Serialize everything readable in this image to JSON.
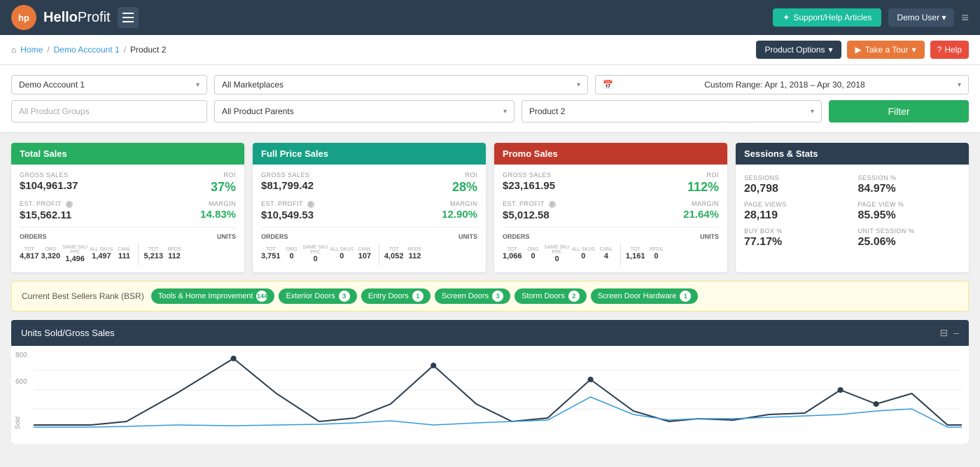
{
  "header": {
    "logo_initials": "hp",
    "logo_name_hello": "Hello",
    "logo_name_profit": "Profit",
    "support_btn": "Support/Help Articles",
    "demo_user": "Demo User",
    "support_icon": "⭐"
  },
  "breadcrumb": {
    "home": "Home",
    "account": "Demo Acccount 1",
    "product": "Product 2"
  },
  "breadcrumb_actions": {
    "product_options": "Product Options",
    "take_tour": "Take a Tour",
    "help": "Help"
  },
  "filters": {
    "account": "Demo Acccount 1",
    "marketplaces": "All Marketplaces",
    "date_range": "Custom Range: Apr 1, 2018 – Apr 30, 2018",
    "product_groups": "All Product Groups",
    "product_parents": "All Product Parents",
    "product_2": "Product 2",
    "filter_btn": "Filter"
  },
  "total_sales": {
    "title": "Total Sales",
    "gross_sales_label": "GROSS SALES",
    "gross_sales_value": "$104,961.37",
    "roi_label": "ROI",
    "roi_value": "37%",
    "est_profit_label": "EST. PROFIT",
    "est_profit_value": "$15,562.11",
    "margin_label": "MARGIN",
    "margin_value": "14.83%",
    "orders_label": "ORDERS",
    "units_label": "UNITS",
    "tot": "4,817",
    "org": "3,320",
    "same_sku_ppc": "1,496",
    "all_skus": "1,497",
    "canl": "111",
    "tot_units": "5,213",
    "rfds": "112"
  },
  "full_price_sales": {
    "title": "Full Price Sales",
    "gross_sales_label": "GROSS SALES",
    "gross_sales_value": "$81,799.42",
    "roi_label": "ROI",
    "roi_value": "28%",
    "est_profit_label": "EST. PROFIT",
    "est_profit_value": "$10,549.53",
    "margin_label": "MARGIN",
    "margin_value": "12.90%",
    "orders_label": "ORDERS",
    "units_label": "UNITS",
    "tot": "3,751",
    "org": "0",
    "same_sku_ppc": "0",
    "all_skus": "0",
    "canl": "107",
    "tot_units": "4,052",
    "rfds": "112"
  },
  "promo_sales": {
    "title": "Promo Sales",
    "gross_sales_label": "GROSS SALES",
    "gross_sales_value": "$23,161.95",
    "roi_label": "ROI",
    "roi_value": "112%",
    "est_profit_label": "EST. PROFIT",
    "est_profit_value": "$5,012.58",
    "margin_label": "MARGIN",
    "margin_value": "21.64%",
    "orders_label": "ORDERS",
    "units_label": "UNITS",
    "tot": "1,066",
    "org": "0",
    "same_sku_ppc": "0",
    "all_skus": "0",
    "canl": "4",
    "tot_units": "1,161",
    "rfds": "0"
  },
  "sessions": {
    "title": "Sessions & Stats",
    "sessions_label": "SESSIONS",
    "sessions_value": "20,798",
    "session_pct_label": "SESSION %",
    "session_pct_value": "84.97%",
    "page_views_label": "PAGE VIEWS",
    "page_views_value": "28,119",
    "page_view_pct_label": "PAGE VIEW %",
    "page_view_pct_value": "85.95%",
    "buy_box_label": "BUY BOX %",
    "buy_box_value": "77.17%",
    "unit_session_label": "UNIT SESSION %",
    "unit_session_value": "25.06%"
  },
  "bsr": {
    "label": "Current Best Sellers Rank (BSR)",
    "tags": [
      {
        "name": "Tools & Home Improvement",
        "count": "144"
      },
      {
        "name": "Exterior Doors",
        "count": "3"
      },
      {
        "name": "Entry Doors",
        "count": "1"
      },
      {
        "name": "Screen Doors",
        "count": "3"
      },
      {
        "name": "Storm Doors",
        "count": "2"
      },
      {
        "name": "Screen Door Hardware",
        "count": "1"
      }
    ]
  },
  "chart": {
    "title": "Units Sold/Gross Sales",
    "y_label_800": "800",
    "y_label_600": "600",
    "x_label": "Sold",
    "expand_icon": "⊟",
    "minimize_icon": "–"
  },
  "colors": {
    "green": "#27ae60",
    "teal": "#16a085",
    "red": "#c0392b",
    "dark": "#2c3e50",
    "orange": "#e8773a",
    "chart_line_dark": "#2c3e50",
    "chart_line_blue": "#3498db"
  }
}
